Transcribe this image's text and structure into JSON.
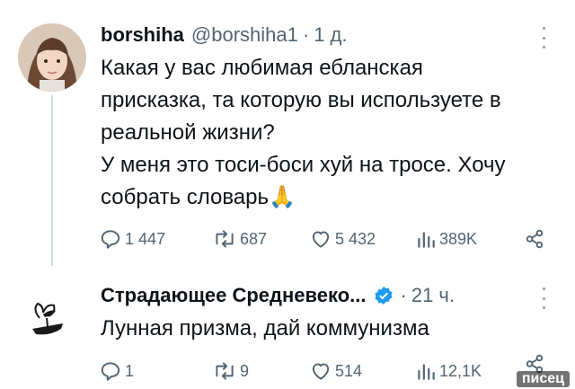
{
  "tweets": [
    {
      "name": "borshiha",
      "handle": "@borshiha1",
      "time": "1 д.",
      "text": "Какая у вас любимая ебланская\nприсказка, та которую вы используете в\nреальной жизни?\nУ меня это тоси-боси хуй на тросе. Хочу\nсобрать словарь🙏",
      "actions": {
        "replies": "1 447",
        "reposts": "687",
        "likes": "5 432",
        "views": "389K"
      }
    },
    {
      "name": "Страдающее Средневеко...",
      "time": "21 ч.",
      "text": "Лунная призма, дай коммунизма",
      "actions": {
        "replies": "1",
        "reposts": "9",
        "likes": "514",
        "views": "12,1K"
      }
    }
  ],
  "watermark": "писец",
  "colors": {
    "text": "#0f1419",
    "secondary": "#536471",
    "verified": "#1d9bf0",
    "thread": "#cfd9de"
  }
}
